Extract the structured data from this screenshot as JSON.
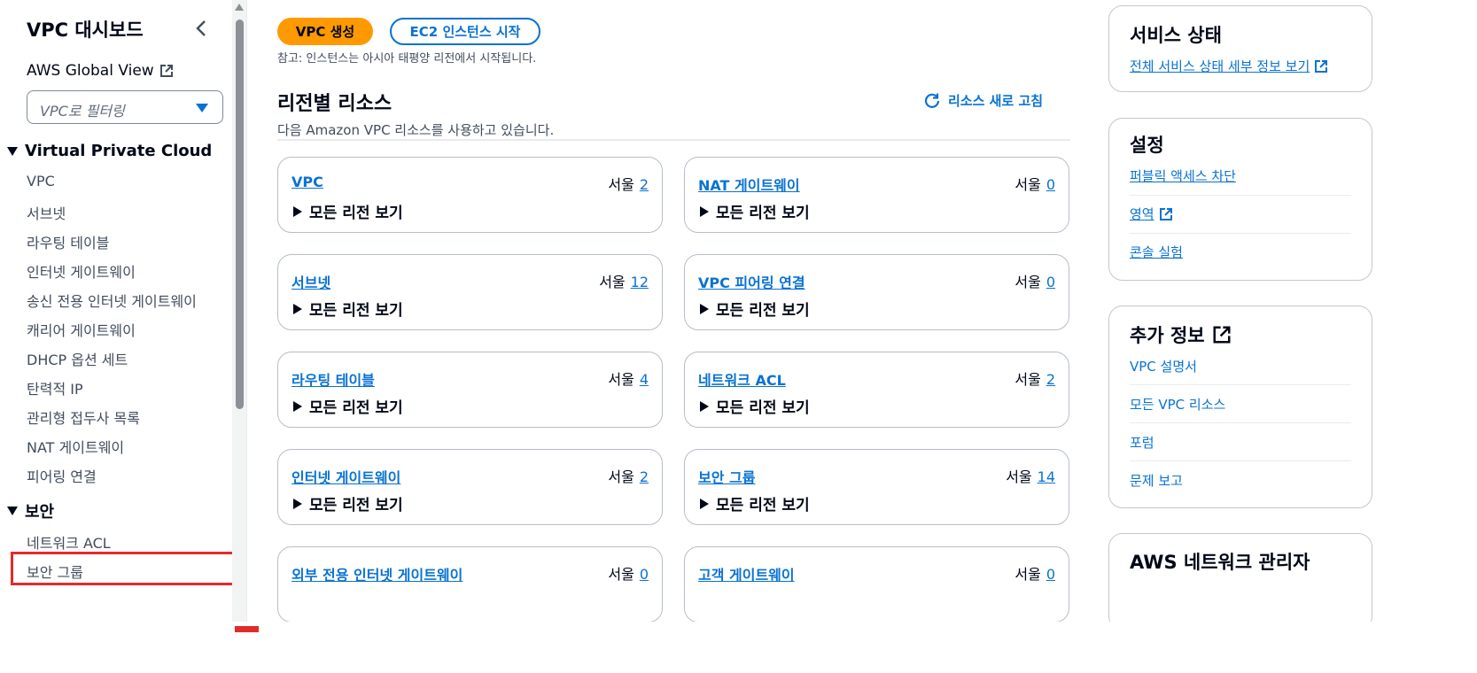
{
  "sidebar": {
    "title": "VPC 대시보드",
    "global_view": "AWS Global View",
    "filter_placeholder": "VPC로 필터링",
    "section_vpc": "Virtual Private Cloud",
    "vpc_items": [
      "VPC",
      "서브넷",
      "라우팅 테이블",
      "인터넷 게이트웨이",
      "송신 전용 인터넷 게이트웨이",
      "캐리어 게이트웨이",
      "DHCP 옵션 세트",
      "탄력적 IP",
      "관리형 접두사 목록",
      "NAT 게이트웨이",
      "피어링 연결"
    ],
    "section_security": "보안",
    "security_items": [
      "네트워크 ACL",
      "보안 그룹"
    ]
  },
  "main": {
    "create_vpc": "VPC 생성",
    "launch_ec2": "EC2 인스턴스 시작",
    "note": "참고: 인스턴스는 아시아 태평양 리전에서 시작됩니다.",
    "resources_title": "리전별 리소스",
    "resources_sub": "다음 Amazon VPC 리소스를 사용하고 있습니다.",
    "refresh": "리소스 새로 고침",
    "expand_label": "모든 리전 보기",
    "region_label": "서울",
    "cards": [
      {
        "name": "VPC",
        "count": "2"
      },
      {
        "name": "NAT 게이트웨이",
        "count": "0"
      },
      {
        "name": "서브넷",
        "count": "12"
      },
      {
        "name": "VPC 피어링 연결",
        "count": "0"
      },
      {
        "name": "라우팅 테이블",
        "count": "4"
      },
      {
        "name": "네트워크 ACL",
        "count": "2"
      },
      {
        "name": "인터넷 게이트웨이",
        "count": "2"
      },
      {
        "name": "보안 그룹",
        "count": "14"
      },
      {
        "name": "외부 전용 인터넷 게이트웨이",
        "count": "0"
      },
      {
        "name": "고객 게이트웨이",
        "count": "0"
      }
    ]
  },
  "right": {
    "service_health_title": "서비스 상태",
    "service_health_link": "전체 서비스 상태 세부 정보 보기",
    "settings_title": "설정",
    "settings_links": [
      "퍼블릭 액세스 차단",
      "영역",
      "콘솔 실험"
    ],
    "more_info_title": "추가 정보",
    "more_info_links": [
      "VPC 설명서",
      "모든 VPC 리소스",
      "포럼",
      "문제 보고"
    ],
    "network_manager_title": "AWS 네트워크 관리자"
  },
  "colors": {
    "link": "#0972d3",
    "primary_button": "#ff9900",
    "highlight": "#e22b2b",
    "text": "#000716"
  },
  "icons": [
    "collapse-chevron-icon",
    "external-link-icon",
    "caret-down-icon",
    "refresh-icon",
    "triangle-expand-icon"
  ]
}
